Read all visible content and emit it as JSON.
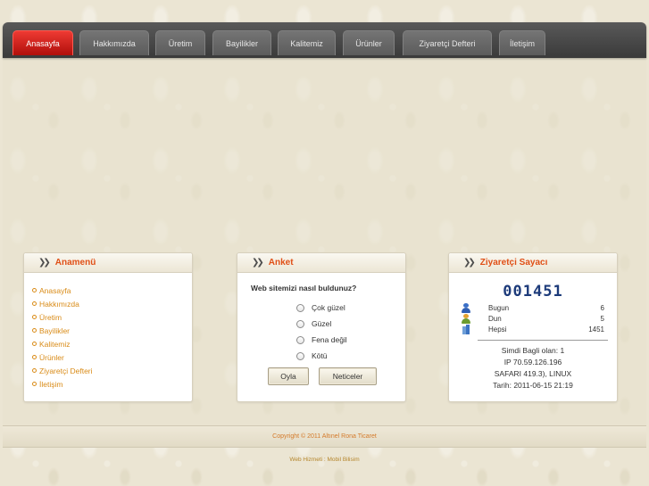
{
  "nav": {
    "items": [
      {
        "label": "Anasayfa",
        "active": true
      },
      {
        "label": "Hakkımızda"
      },
      {
        "label": "Üretim"
      },
      {
        "label": "Bayilikler"
      },
      {
        "label": "Kalitemiz"
      },
      {
        "label": "Ürünler"
      },
      {
        "label": "Ziyaretçi Defteri"
      },
      {
        "label": "İletişim"
      }
    ]
  },
  "menu_panel": {
    "title": "Anamenü",
    "items": [
      "Anasayfa",
      "Hakkımızda",
      "Üretim",
      "Bayilikler",
      "Kalitemiz",
      "Ürünler",
      "Ziyaretçi Defteri",
      "İletişim"
    ]
  },
  "poll": {
    "title": "Anket",
    "question": "Web sitemizi nasıl buldunuz?",
    "options": [
      "Çok güzel",
      "Güzel",
      "Fena değil",
      "Kötü"
    ],
    "vote_label": "Oyla",
    "results_label": "Neticeler"
  },
  "counter": {
    "title": "Ziyaretçi Sayacı",
    "total_digits": "001451",
    "rows": [
      {
        "label": "Bugun",
        "value": "6",
        "icon": "user-blue-icon"
      },
      {
        "label": "Dun",
        "value": "5",
        "icon": "user-orange-icon"
      },
      {
        "label": "Hepsi",
        "value": "1451",
        "icon": "building-icon"
      }
    ],
    "online": "Simdi Bagli olan: 1",
    "ip": "IP 70.59.126.196",
    "browser": "SAFARI 419.3), LINUX",
    "date": "Tarih: 2011-06-15 21:19"
  },
  "footer": {
    "copyright": "Copyright © 2011 Altınel Rona Ticaret",
    "credit": "Web Hizmeti : Mobil Bilisim"
  },
  "colors": {
    "accent": "#e04f16",
    "link": "#d98b17",
    "nav_active": "#d0201a"
  }
}
